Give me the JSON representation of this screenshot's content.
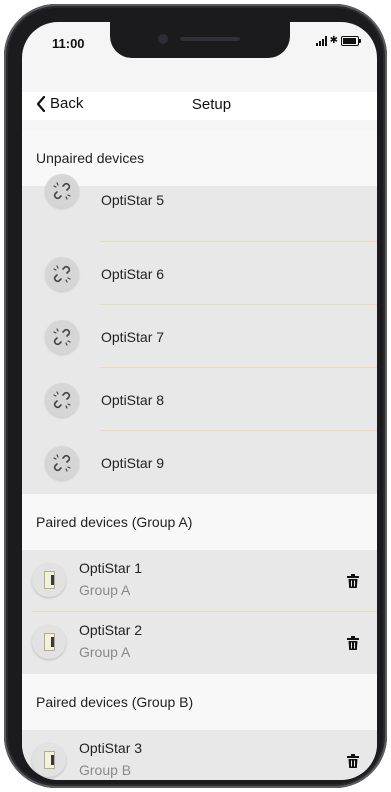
{
  "status": {
    "time": "11:00"
  },
  "nav": {
    "back_label": "Back",
    "title": "Setup"
  },
  "unpaired": {
    "header": "Unpaired devices",
    "items": [
      {
        "label": "OptiStar 5"
      },
      {
        "label": "OptiStar 6"
      },
      {
        "label": "OptiStar 7"
      },
      {
        "label": "OptiStar 8"
      },
      {
        "label": "OptiStar 9"
      }
    ]
  },
  "group_a": {
    "header": "Paired devices (Group A)",
    "items": [
      {
        "name": "OptiStar 1",
        "group": "Group A"
      },
      {
        "name": "OptiStar 2",
        "group": "Group A"
      }
    ]
  },
  "group_b": {
    "header": "Paired devices (Group B)",
    "items": [
      {
        "name": "OptiStar 3",
        "group": "Group B"
      }
    ]
  },
  "icons": {
    "unpaired": "broken-link-icon",
    "paired": "device-icon",
    "delete": "trash-icon",
    "back": "chevron-left-icon"
  },
  "colors": {
    "separator": "#f1d8b4",
    "row_bg": "#e8e8e8",
    "section_bg": "#f8f8f8"
  }
}
